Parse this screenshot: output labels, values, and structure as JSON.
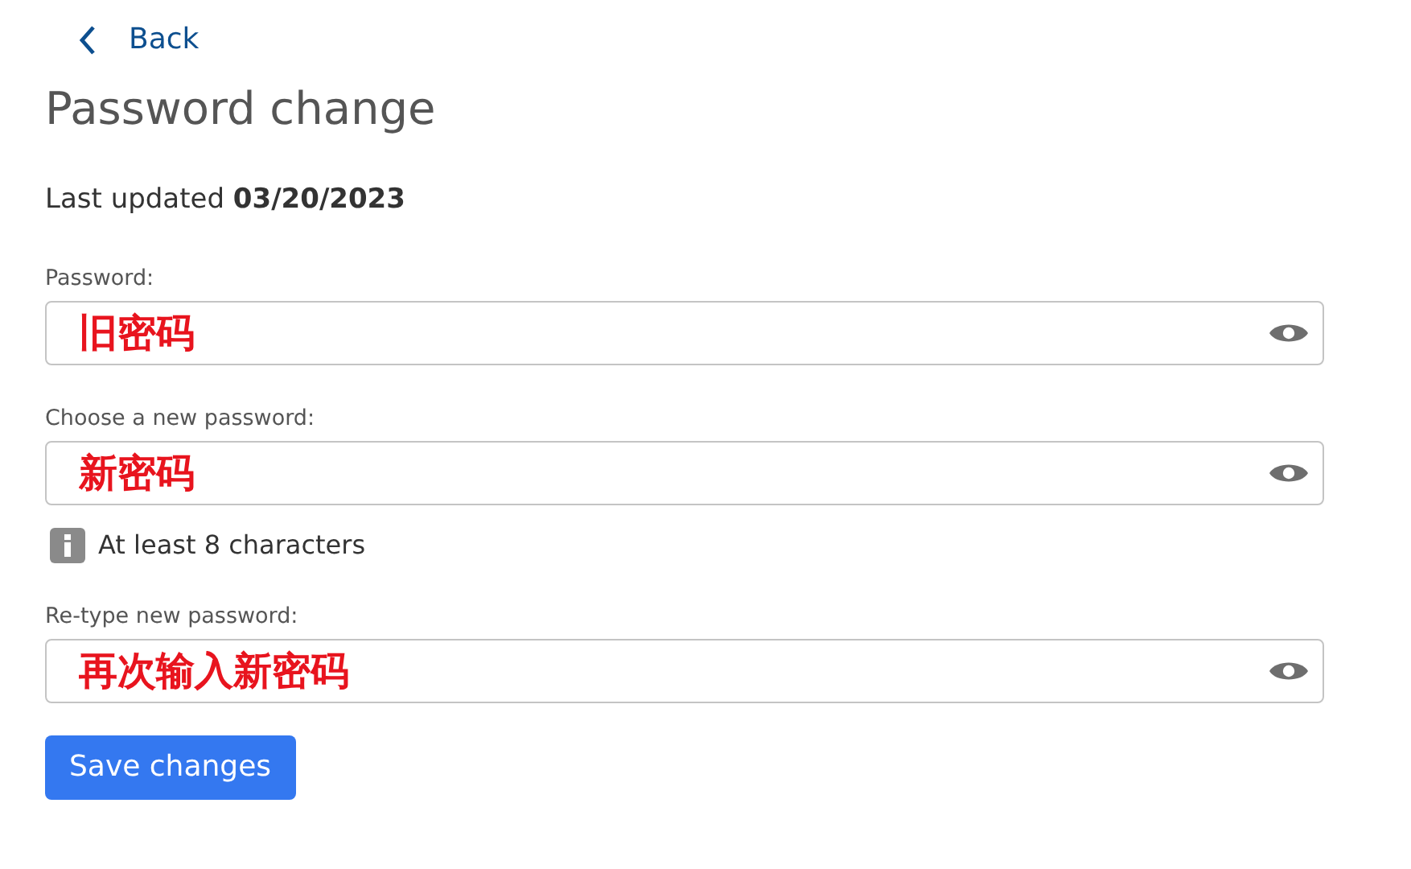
{
  "back_link": {
    "label": "Back"
  },
  "title": "Password change",
  "last_updated": {
    "label": "Last updated",
    "date": "03/20/2023"
  },
  "fields": [
    {
      "label": "Password:",
      "value": "旧密码"
    },
    {
      "label": "Choose a new password:",
      "value": "新密码",
      "hint": "At least 8 characters"
    },
    {
      "label": "Re-type new password:",
      "value": "再次输入新密码"
    }
  ],
  "save_button": {
    "label": "Save changes"
  }
}
